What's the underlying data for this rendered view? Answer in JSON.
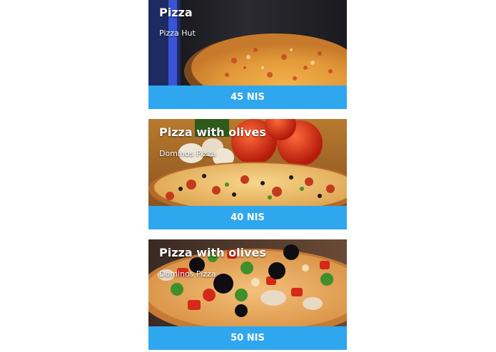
{
  "colors": {
    "accent": "#2ea7ee",
    "text_on_image": "#ffffff",
    "background": "#ffffff"
  },
  "cards": [
    {
      "title": "Pizza",
      "subtitle": "Pizza Hut",
      "price": "45 NIS",
      "image_icon": "pizza-photo-icon"
    },
    {
      "title": "Pizza with olives",
      "subtitle": "Dominos Pizza",
      "price": "40 NIS",
      "image_icon": "pizza-photo-icon"
    },
    {
      "title": "Pizza with olives",
      "subtitle": "Dominos Pizza",
      "price": "50 NIS",
      "image_icon": "pizza-photo-icon"
    }
  ]
}
